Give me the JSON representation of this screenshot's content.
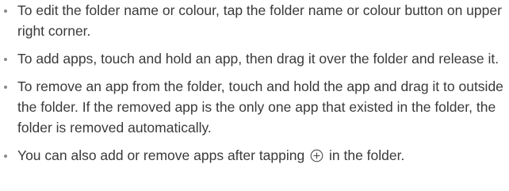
{
  "bullets": [
    {
      "text": "To edit the folder name or colour, tap the folder name or colour button on upper right corner."
    },
    {
      "text": "To add apps, touch and hold an app, then drag it over the folder and release it."
    },
    {
      "text": "To remove an app from the folder, touch and hold the app and drag it to outside the folder. If the removed app is the only one app that existed in the folder, the folder is removed automatically."
    },
    {
      "text_before": "You can also add or remove apps after tapping",
      "icon": "plus-circle-icon",
      "text_after": "in the folder."
    }
  ]
}
